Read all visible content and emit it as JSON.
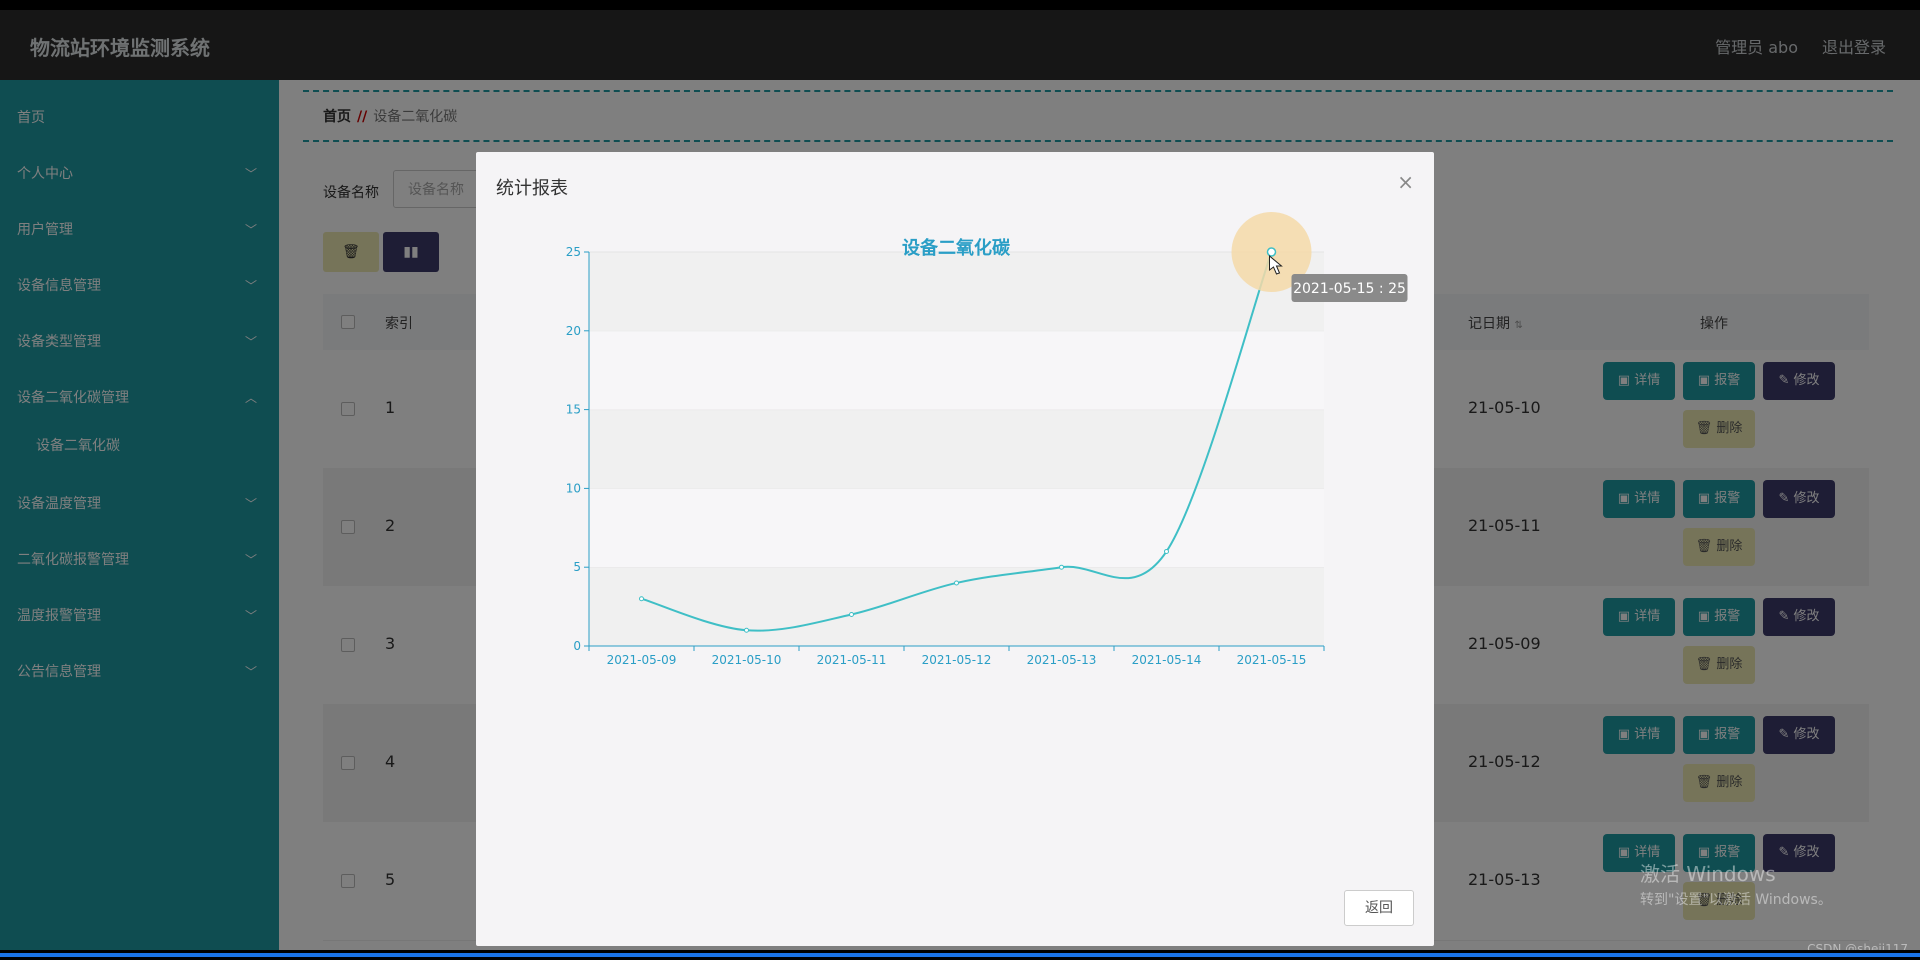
{
  "header": {
    "app_title": "物流站环境监测系统",
    "user_label": "管理员 abo",
    "logout_label": "退出登录"
  },
  "sidebar": {
    "items": [
      {
        "label": "首页",
        "has_chevron": false
      },
      {
        "label": "个人中心",
        "has_chevron": true
      },
      {
        "label": "用户管理",
        "has_chevron": true
      },
      {
        "label": "设备信息管理",
        "has_chevron": true
      },
      {
        "label": "设备类型管理",
        "has_chevron": true
      },
      {
        "label": "设备二氧化碳管理",
        "has_chevron": true
      },
      {
        "label": "设备温度管理",
        "has_chevron": true
      },
      {
        "label": "二氧化碳报警管理",
        "has_chevron": true
      },
      {
        "label": "温度报警管理",
        "has_chevron": true
      },
      {
        "label": "公告信息管理",
        "has_chevron": true
      }
    ],
    "sub_item": "设备二氧化碳"
  },
  "breadcrumb": {
    "home": "首页",
    "separator": "//",
    "current": "设备二氧化碳"
  },
  "filter": {
    "label": "设备名称",
    "placeholder": "设备名称"
  },
  "table": {
    "headers": {
      "index": "索引",
      "date": "记日期",
      "actions": "操作"
    },
    "rows": [
      {
        "index": "1",
        "date": "21-05-10"
      },
      {
        "index": "2",
        "date": "21-05-11"
      },
      {
        "index": "3",
        "date": "21-05-09"
      },
      {
        "index": "4",
        "date": "21-05-12"
      },
      {
        "index": "5",
        "date": "21-05-13"
      }
    ],
    "action_labels": {
      "detail": "详情",
      "alarm": "报警",
      "edit": "修改",
      "delete": "删除"
    }
  },
  "modal": {
    "title": "统计报表",
    "close_label": "×",
    "back_label": "返回"
  },
  "tooltip": {
    "text": "2021-05-15 : 25"
  },
  "chart_data": {
    "type": "line",
    "title": "设备二氧化碳",
    "categories": [
      "2021-05-09",
      "2021-05-10",
      "2021-05-11",
      "2021-05-12",
      "2021-05-13",
      "2021-05-14",
      "2021-05-15"
    ],
    "values": [
      3,
      1,
      2,
      4,
      5,
      6,
      25
    ],
    "ylim": [
      0,
      25
    ],
    "yticks": [
      0,
      5,
      10,
      15,
      20,
      25
    ],
    "smooth": true,
    "grid": "alternating-bands",
    "line_color": "#3fbfc6",
    "axis_color": "#2a9ec6"
  },
  "watermark": {
    "line1": "激活 Windows",
    "line2": "转到\"设置\"以激活 Windows。"
  },
  "credit": "CSDN @sheji117",
  "colors": {
    "teal": "#1f9aa3",
    "purple": "#3d3a6b",
    "khaki": "#ece9b3",
    "topbar": "#2d2d2d"
  }
}
